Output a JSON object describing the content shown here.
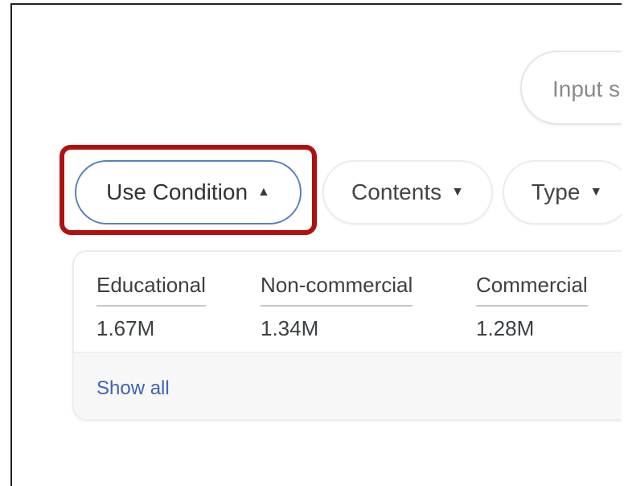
{
  "search": {
    "placeholder_text": "Input s"
  },
  "filters": [
    {
      "label": "Use Condition",
      "caret": "▲",
      "active": true
    },
    {
      "label": "Contents",
      "caret": "▼",
      "active": false
    },
    {
      "label": "Type",
      "caret": "▼",
      "active": false
    }
  ],
  "highlight_color": "#b01010",
  "use_condition_panel": {
    "options": [
      {
        "label": "Educational",
        "count": "1.67M"
      },
      {
        "label": "Non-commercial",
        "count": "1.34M"
      },
      {
        "label": "Commercial",
        "count": "1.28M"
      }
    ],
    "show_all_label": "Show all"
  },
  "icons": {
    "caret_up": "caret-up-icon",
    "caret_down": "caret-down-icon"
  }
}
